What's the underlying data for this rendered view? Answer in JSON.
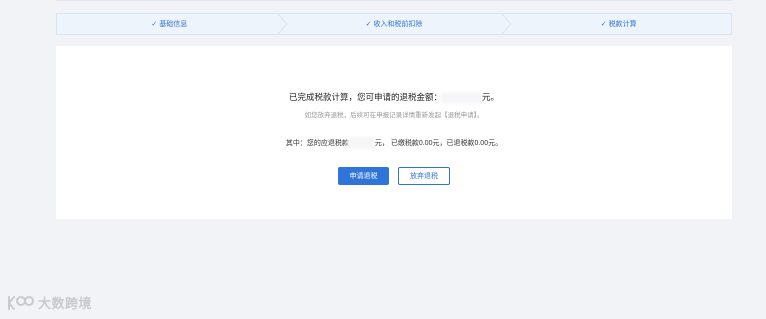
{
  "steps": [
    {
      "check": "✓",
      "label": "基础信息"
    },
    {
      "check": "✓",
      "label": "收入和税前扣除"
    },
    {
      "check": "✓",
      "label": "税款计算"
    }
  ],
  "result": {
    "main_prefix": "已完成税款计算，您可申请的退税金额：",
    "main_suffix": "元。",
    "sub_text": "如您放弃退税，后续可在申报记录详情重新发起【退税申请】。",
    "detail_prefix": "其中：您的应退税款",
    "detail_middle": "元， 已缴税款0.00元，已退税款0.00元。"
  },
  "buttons": {
    "apply": "申请退税",
    "abandon": "放弃退税"
  },
  "watermark": {
    "text": "大数跨境"
  },
  "colors": {
    "accent": "#2f74d8",
    "step_bg": "#eef4fc",
    "page_bg": "#f2f3f7"
  },
  "icons": {
    "step_done": "check-icon",
    "watermark_logo": "brand-logo-icon"
  }
}
